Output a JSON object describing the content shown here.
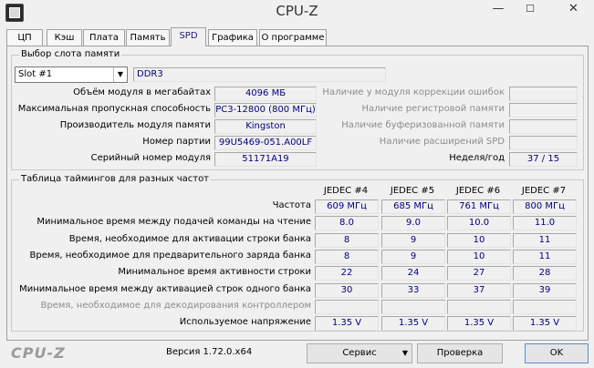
{
  "window": {
    "title": "CPU-Z",
    "minimize": "—",
    "maximize": "☐",
    "close": "✕"
  },
  "tabs": [
    "ЦП",
    "Кэш",
    "Плата",
    "Память",
    "SPD",
    "Графика",
    "О программе"
  ],
  "slot": {
    "group_title": "Выбор слота памяти",
    "selected": "Slot #1",
    "type": "DDR3",
    "labels": {
      "size": "Объём модуля в мегабайтах",
      "bandwidth": "Максимальная пропускная способность",
      "manufacturer": "Производитель модуля памяти",
      "part": "Номер партии",
      "serial": "Серийный номер модуля",
      "ecc": "Наличие у модуля коррекции ошибок",
      "registered": "Наличие регистровой памяти",
      "buffered": "Наличие буферизованной памяти",
      "spd_ext": "Наличие расширений SPD",
      "week_year": "Неделя/год"
    },
    "values": {
      "size": "4096 МБ",
      "bandwidth": "PC3-12800 (800 МГц)",
      "manufacturer": "Kingston",
      "part": "99U5469-051.A00LF",
      "serial": "51171A19",
      "week_year": "37 / 15"
    }
  },
  "timings": {
    "group_title": "Таблица таймингов для разных частот",
    "columns": [
      "JEDEC #4",
      "JEDEC #5",
      "JEDEC #6",
      "JEDEC #7"
    ],
    "rows": [
      {
        "label": "Частота",
        "values": [
          "609 МГц",
          "685 МГц",
          "761 МГц",
          "800 МГц"
        ]
      },
      {
        "label": "Минимальное время между подачей команды на чтение",
        "values": [
          "8.0",
          "9.0",
          "10.0",
          "11.0"
        ]
      },
      {
        "label": "Время, необходимое для активации строки банка",
        "values": [
          "8",
          "9",
          "10",
          "11"
        ]
      },
      {
        "label": "Время, необходимое для предварительного заряда банка",
        "values": [
          "8",
          "9",
          "10",
          "11"
        ]
      },
      {
        "label": "Минимальное время активности строки",
        "values": [
          "22",
          "24",
          "27",
          "28"
        ]
      },
      {
        "label": "Минимальное время между активацией строк одного банка",
        "values": [
          "30",
          "33",
          "37",
          "39"
        ]
      },
      {
        "label": "Время, необходимое для декодирования контроллером",
        "values": [
          "",
          "",
          "",
          ""
        ],
        "disabled": true
      },
      {
        "label": "Используемое напряжение",
        "values": [
          "1.35 V",
          "1.35 V",
          "1.35 V",
          "1.35 V"
        ]
      }
    ]
  },
  "footer": {
    "logo": "CPU-Z",
    "version": "Версия 1.72.0.x64",
    "service": "Сервис",
    "validate": "Проверка",
    "ok": "OK"
  }
}
